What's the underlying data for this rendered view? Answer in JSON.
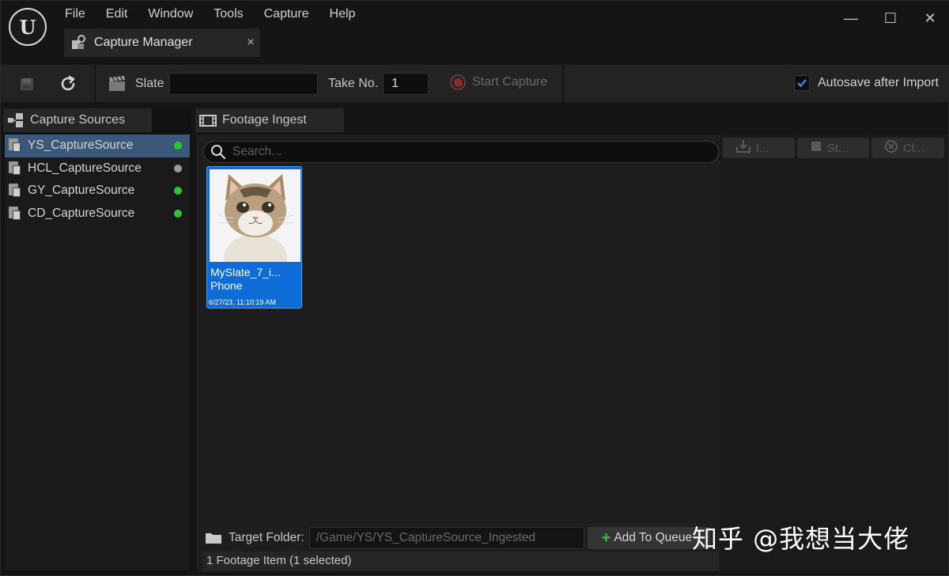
{
  "menu": [
    "File",
    "Edit",
    "Window",
    "Tools",
    "Capture",
    "Help"
  ],
  "document_tab": {
    "title": "Capture Manager",
    "close": "×"
  },
  "window_controls": {
    "minimize": "—",
    "maximize": "☐",
    "close": "✕"
  },
  "toolbar": {
    "slate_label": "Slate",
    "slate_value": "",
    "take_label": "Take No.",
    "take_value": "1",
    "start_capture": "Start Capture",
    "autosave_label": "Autosave after Import",
    "autosave_checked": true
  },
  "capture_sources": {
    "tab_label": "Capture Sources",
    "items": [
      {
        "label": "YS_CaptureSource",
        "status_color": "#2ec42e",
        "selected": true
      },
      {
        "label": "HCL_CaptureSource",
        "status_color": "#9a9a9a",
        "selected": false
      },
      {
        "label": "GY_CaptureSource",
        "status_color": "#2ec42e",
        "selected": false
      },
      {
        "label": "CD_CaptureSource",
        "status_color": "#2ec42e",
        "selected": false
      }
    ]
  },
  "footage_ingest": {
    "tab_label": "Footage Ingest",
    "search_placeholder": "Search...",
    "tile": {
      "name": "MySlate_7_i...",
      "type": "Phone",
      "date": "6/27/23, 11:10:19 AM"
    },
    "target_folder_label": "Target Folder:",
    "target_folder_path": "/Game/YS/YS_CaptureSource_Ingested",
    "add_button": "Add To Queue",
    "status": "1 Footage Item (1 selected)"
  },
  "queue_buttons": [
    {
      "label": "I...",
      "icon": "import-icon"
    },
    {
      "label": "St...",
      "icon": "stop-icon"
    },
    {
      "label": "Cl...",
      "icon": "clear-icon"
    }
  ],
  "watermark": "知乎 @我想当大佬",
  "accent_color": "#0f6bd6"
}
